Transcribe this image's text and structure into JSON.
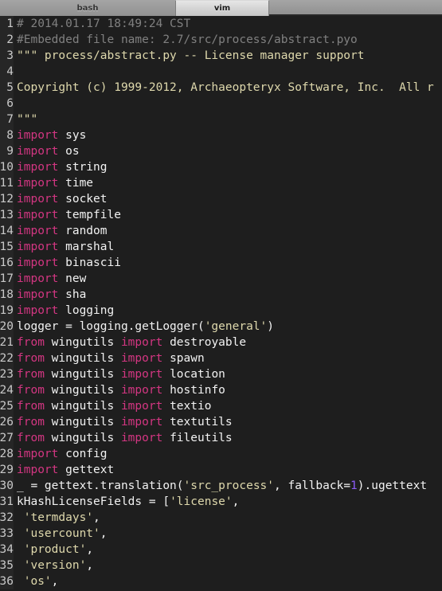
{
  "window": {
    "tabs": [
      {
        "label": "bash",
        "active": false
      },
      {
        "label": "vim",
        "active": true
      }
    ]
  },
  "editor": {
    "filetype": "python",
    "colors": {
      "background": "#1e1e1e",
      "gutter_background": "#262626",
      "line_number": "#c9c9c9",
      "comment": "#808080",
      "string": "#ded8ac",
      "keyword": "#d33682",
      "plain_text": "#f2f2f2",
      "number": "#8b5cf6"
    },
    "lines": [
      {
        "no": "1",
        "tokens": [
          {
            "t": "comment",
            "s": "# 2014.01.17 18:49:24 CST"
          }
        ]
      },
      {
        "no": "2",
        "tokens": [
          {
            "t": "comment",
            "s": "#Embedded file name: 2.7/src/process/abstract.pyo"
          }
        ]
      },
      {
        "no": "3",
        "tokens": [
          {
            "t": "string",
            "s": "\"\"\" process/abstract.py -- License manager support"
          }
        ]
      },
      {
        "no": "4",
        "tokens": []
      },
      {
        "no": "5",
        "tokens": [
          {
            "t": "string",
            "s": "Copyright (c) 1999-2012, Archaeopteryx Software, Inc.  All r"
          }
        ]
      },
      {
        "no": "6",
        "tokens": []
      },
      {
        "no": "7",
        "tokens": [
          {
            "t": "string",
            "s": "\"\"\""
          }
        ]
      },
      {
        "no": "8",
        "tokens": [
          {
            "t": "keyword",
            "s": "import"
          },
          {
            "t": "plain",
            "s": " sys"
          }
        ]
      },
      {
        "no": "9",
        "tokens": [
          {
            "t": "keyword",
            "s": "import"
          },
          {
            "t": "plain",
            "s": " os"
          }
        ]
      },
      {
        "no": "10",
        "tokens": [
          {
            "t": "keyword",
            "s": "import"
          },
          {
            "t": "plain",
            "s": " string"
          }
        ]
      },
      {
        "no": "11",
        "tokens": [
          {
            "t": "keyword",
            "s": "import"
          },
          {
            "t": "plain",
            "s": " time"
          }
        ]
      },
      {
        "no": "12",
        "tokens": [
          {
            "t": "keyword",
            "s": "import"
          },
          {
            "t": "plain",
            "s": " socket"
          }
        ]
      },
      {
        "no": "13",
        "tokens": [
          {
            "t": "keyword",
            "s": "import"
          },
          {
            "t": "plain",
            "s": " tempfile"
          }
        ]
      },
      {
        "no": "14",
        "tokens": [
          {
            "t": "keyword",
            "s": "import"
          },
          {
            "t": "plain",
            "s": " random"
          }
        ]
      },
      {
        "no": "15",
        "tokens": [
          {
            "t": "keyword",
            "s": "import"
          },
          {
            "t": "plain",
            "s": " marshal"
          }
        ]
      },
      {
        "no": "16",
        "tokens": [
          {
            "t": "keyword",
            "s": "import"
          },
          {
            "t": "plain",
            "s": " binascii"
          }
        ]
      },
      {
        "no": "17",
        "tokens": [
          {
            "t": "keyword",
            "s": "import"
          },
          {
            "t": "plain",
            "s": " new"
          }
        ]
      },
      {
        "no": "18",
        "tokens": [
          {
            "t": "keyword",
            "s": "import"
          },
          {
            "t": "plain",
            "s": " sha"
          }
        ]
      },
      {
        "no": "19",
        "tokens": [
          {
            "t": "keyword",
            "s": "import"
          },
          {
            "t": "plain",
            "s": " logging"
          }
        ]
      },
      {
        "no": "20",
        "tokens": [
          {
            "t": "plain",
            "s": "logger = logging.getLogger("
          },
          {
            "t": "string",
            "s": "'general'"
          },
          {
            "t": "plain",
            "s": ")"
          }
        ]
      },
      {
        "no": "21",
        "tokens": [
          {
            "t": "keyword",
            "s": "from"
          },
          {
            "t": "plain",
            "s": " wingutils "
          },
          {
            "t": "keyword",
            "s": "import"
          },
          {
            "t": "plain",
            "s": " destroyable"
          }
        ]
      },
      {
        "no": "22",
        "tokens": [
          {
            "t": "keyword",
            "s": "from"
          },
          {
            "t": "plain",
            "s": " wingutils "
          },
          {
            "t": "keyword",
            "s": "import"
          },
          {
            "t": "plain",
            "s": " spawn"
          }
        ]
      },
      {
        "no": "23",
        "tokens": [
          {
            "t": "keyword",
            "s": "from"
          },
          {
            "t": "plain",
            "s": " wingutils "
          },
          {
            "t": "keyword",
            "s": "import"
          },
          {
            "t": "plain",
            "s": " location"
          }
        ]
      },
      {
        "no": "24",
        "tokens": [
          {
            "t": "keyword",
            "s": "from"
          },
          {
            "t": "plain",
            "s": " wingutils "
          },
          {
            "t": "keyword",
            "s": "import"
          },
          {
            "t": "plain",
            "s": " hostinfo"
          }
        ]
      },
      {
        "no": "25",
        "tokens": [
          {
            "t": "keyword",
            "s": "from"
          },
          {
            "t": "plain",
            "s": " wingutils "
          },
          {
            "t": "keyword",
            "s": "import"
          },
          {
            "t": "plain",
            "s": " textio"
          }
        ]
      },
      {
        "no": "26",
        "tokens": [
          {
            "t": "keyword",
            "s": "from"
          },
          {
            "t": "plain",
            "s": " wingutils "
          },
          {
            "t": "keyword",
            "s": "import"
          },
          {
            "t": "plain",
            "s": " textutils"
          }
        ]
      },
      {
        "no": "27",
        "tokens": [
          {
            "t": "keyword",
            "s": "from"
          },
          {
            "t": "plain",
            "s": " wingutils "
          },
          {
            "t": "keyword",
            "s": "import"
          },
          {
            "t": "plain",
            "s": " fileutils"
          }
        ]
      },
      {
        "no": "28",
        "tokens": [
          {
            "t": "keyword",
            "s": "import"
          },
          {
            "t": "plain",
            "s": " config"
          }
        ]
      },
      {
        "no": "29",
        "tokens": [
          {
            "t": "keyword",
            "s": "import"
          },
          {
            "t": "plain",
            "s": " gettext"
          }
        ]
      },
      {
        "no": "30",
        "tokens": [
          {
            "t": "plain",
            "s": "_ = gettext.translation("
          },
          {
            "t": "string",
            "s": "'src_process'"
          },
          {
            "t": "plain",
            "s": ", fallback="
          },
          {
            "t": "number",
            "s": "1"
          },
          {
            "t": "plain",
            "s": ").ugettext"
          }
        ]
      },
      {
        "no": "31",
        "tokens": [
          {
            "t": "plain",
            "s": "kHashLicenseFields = ["
          },
          {
            "t": "string",
            "s": "'license'"
          },
          {
            "t": "plain",
            "s": ","
          }
        ]
      },
      {
        "no": "32",
        "tokens": [
          {
            "t": "string",
            "s": " 'termdays'"
          },
          {
            "t": "plain",
            "s": ","
          }
        ]
      },
      {
        "no": "33",
        "tokens": [
          {
            "t": "string",
            "s": " 'usercount'"
          },
          {
            "t": "plain",
            "s": ","
          }
        ]
      },
      {
        "no": "34",
        "tokens": [
          {
            "t": "string",
            "s": " 'product'"
          },
          {
            "t": "plain",
            "s": ","
          }
        ]
      },
      {
        "no": "35",
        "tokens": [
          {
            "t": "string",
            "s": " 'version'"
          },
          {
            "t": "plain",
            "s": ","
          }
        ]
      },
      {
        "no": "36",
        "tokens": [
          {
            "t": "string",
            "s": " 'os'"
          },
          {
            "t": "plain",
            "s": ","
          }
        ]
      }
    ]
  }
}
